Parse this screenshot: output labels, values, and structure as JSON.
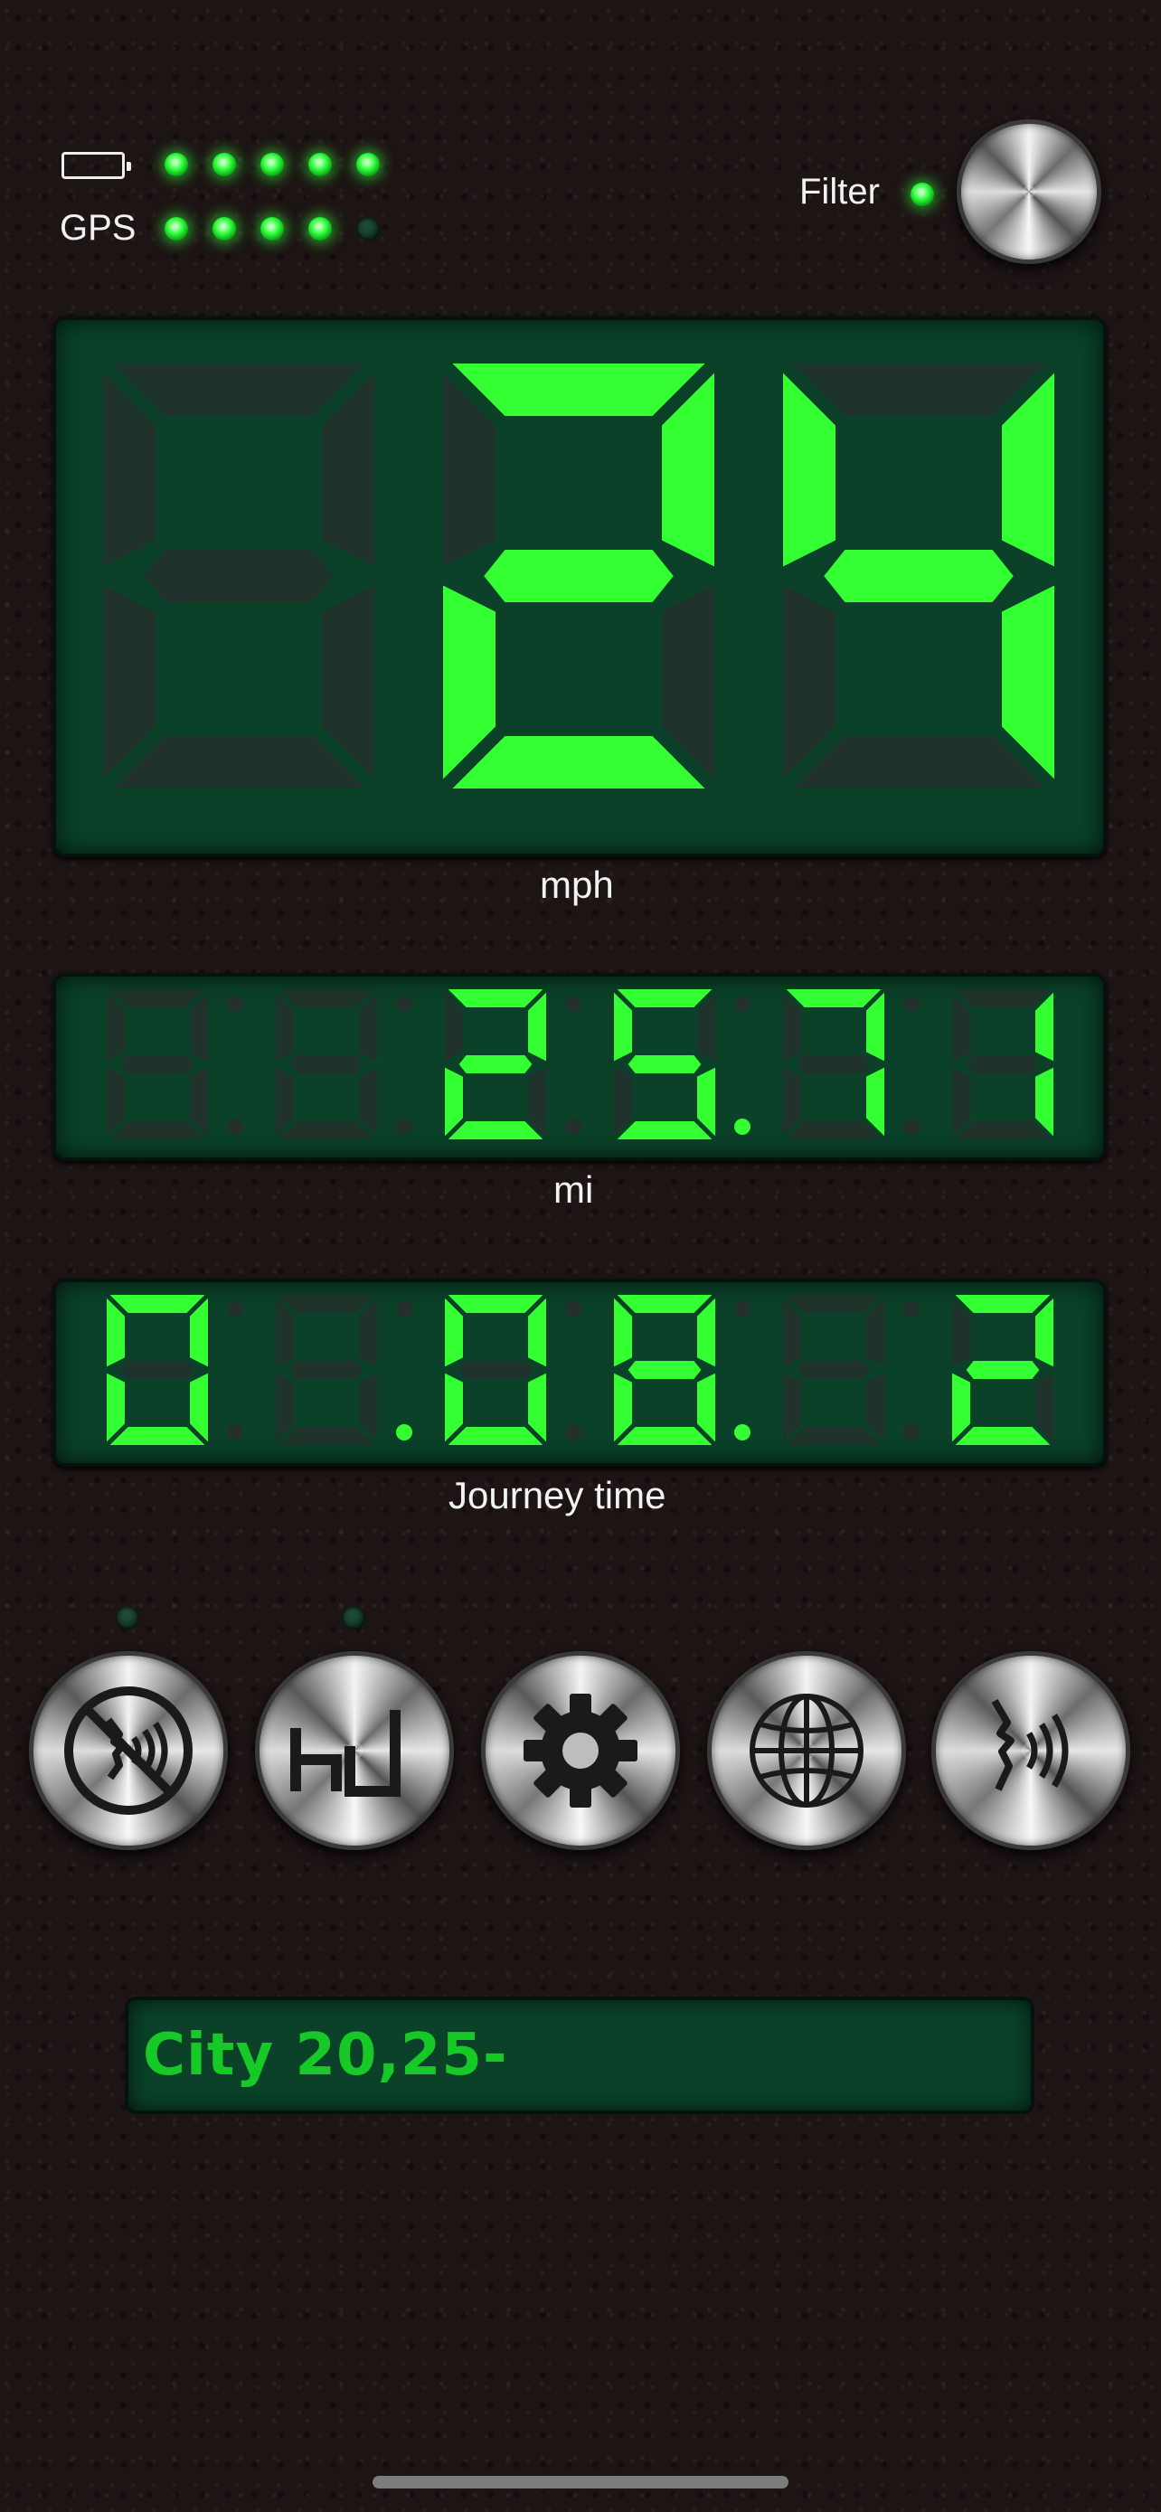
{
  "status": {
    "battery_icon": "battery-icon",
    "battery_level_leds_lit": 5,
    "gps_label": "GPS",
    "gps_signal_leds_lit": 4,
    "gps_signal_leds_total": 5,
    "filter_label": "Filter",
    "filter_on": true
  },
  "speed": {
    "display": "24",
    "unit": "mph"
  },
  "distance": {
    "digits": [
      "8",
      "8",
      "2",
      "5",
      "7",
      "1"
    ],
    "lit": [
      false,
      false,
      true,
      true,
      true,
      true
    ],
    "decimal_after_index": 3,
    "unit": "mi"
  },
  "journey": {
    "digits": [
      "0",
      "1",
      "0",
      "8",
      "1",
      "2"
    ],
    "lit": [
      true,
      false,
      true,
      true,
      false,
      true
    ],
    "label": "Journey time"
  },
  "buttons": [
    {
      "name": "mute-voice-button",
      "icon": "no-voice-icon",
      "indicator": true
    },
    {
      "name": "units-button",
      "icon": "units-icon",
      "indicator": true
    },
    {
      "name": "settings-button",
      "icon": "gear-icon",
      "indicator": false
    },
    {
      "name": "globe-button",
      "icon": "globe-icon",
      "indicator": false
    },
    {
      "name": "voice-button",
      "icon": "voice-icon",
      "indicator": false
    }
  ],
  "ticker": {
    "text": "City 20,25-"
  },
  "colors": {
    "lcd_on": "#33ff33",
    "lcd_off": "#23302b",
    "panel": "#0a4128",
    "ticker_text": "#16c927"
  }
}
